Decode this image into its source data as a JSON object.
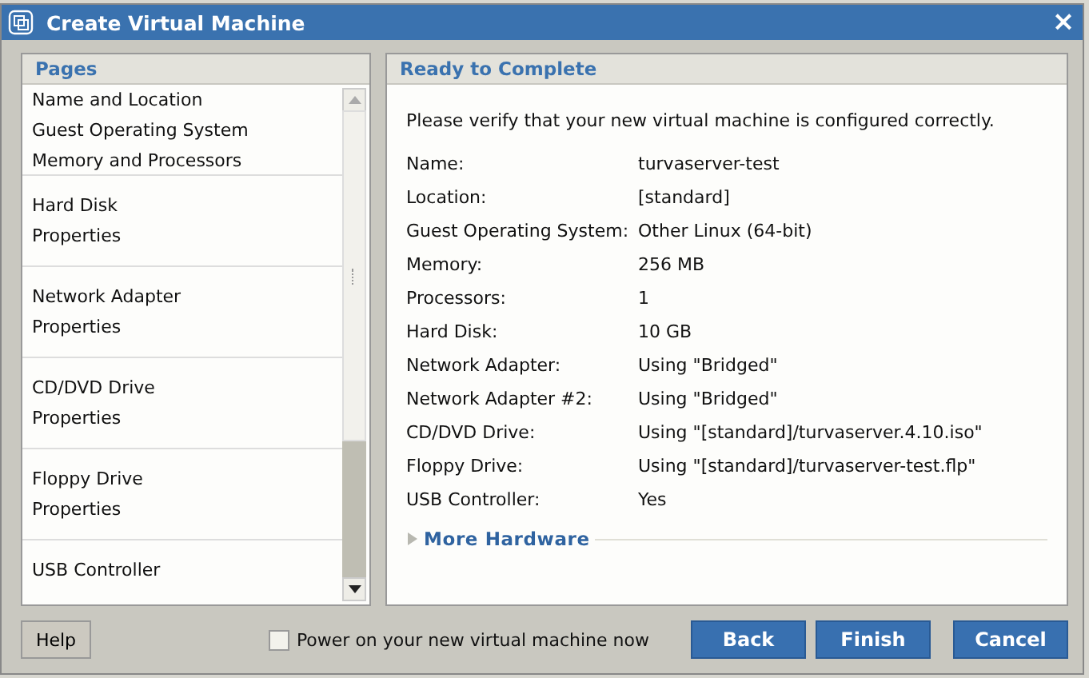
{
  "window": {
    "title": "Create Virtual Machine",
    "close": "×"
  },
  "pages": {
    "title": "Pages",
    "groups": [
      {
        "items": [
          "Name and Location",
          "Guest Operating System",
          "Memory and Processors"
        ]
      },
      {
        "items": [
          "Hard Disk",
          "Properties"
        ]
      },
      {
        "items": [
          "Network Adapter",
          "Properties"
        ]
      },
      {
        "items": [
          "CD/DVD Drive",
          "Properties"
        ]
      },
      {
        "items": [
          "Floppy Drive",
          "Properties"
        ]
      },
      {
        "items": [
          "USB Controller"
        ]
      }
    ]
  },
  "summary": {
    "title": "Ready to Complete",
    "intro": "Please verify that your new virtual machine is configured correctly.",
    "rows": [
      {
        "label": "Name:",
        "value": "turvaserver-test"
      },
      {
        "label": "Location:",
        "value": "[standard]"
      },
      {
        "label": "Guest Operating System:",
        "value": "Other Linux (64-bit)"
      },
      {
        "label": "Memory:",
        "value": "256 MB"
      },
      {
        "label": "Processors:",
        "value": "1"
      },
      {
        "label": "Hard Disk:",
        "value": "10 GB"
      },
      {
        "label": "Network Adapter:",
        "value": "Using \"Bridged\""
      },
      {
        "label": "Network Adapter #2:",
        "value": "Using \"Bridged\""
      },
      {
        "label": "CD/DVD Drive:",
        "value": "Using \"[standard]/turvaserver.4.10.iso\""
      },
      {
        "label": "Floppy Drive:",
        "value": "Using \"[standard]/turvaserver-test.flp\""
      },
      {
        "label": "USB Controller:",
        "value": "Yes"
      }
    ],
    "more": {
      "label": "More Hardware",
      "expanded": false
    }
  },
  "footer": {
    "help": "Help",
    "power_on": {
      "label": "Power on your new virtual machine now",
      "checked": false
    },
    "buttons": [
      "Back",
      "Finish",
      "Cancel"
    ]
  }
}
